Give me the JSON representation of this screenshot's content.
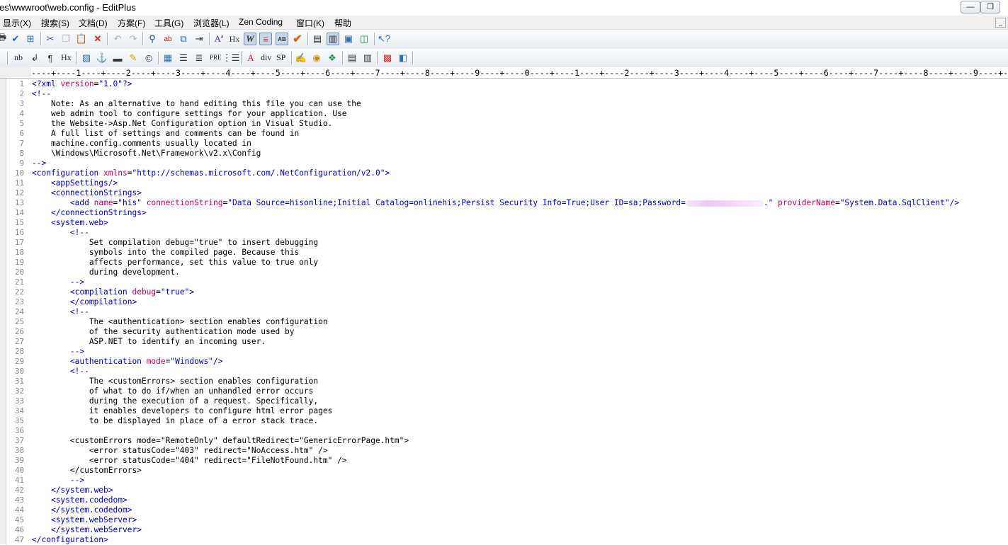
{
  "window": {
    "title": "es\\wwwroot\\web.config - EditPlus",
    "min_glyph": "—",
    "restore_glyph": "❐"
  },
  "menu": {
    "items": [
      "显示(X)",
      "搜索(S)",
      "文档(D)",
      "方案(F)",
      "工具(G)",
      "浏览器(L)",
      "Zen Coding",
      "窗口(K)",
      "帮助"
    ]
  },
  "toolbar2_text": {
    "nb": "nb",
    "hx": "Hx",
    "pre": "PRE",
    "div": "div",
    "sp": "SP"
  },
  "ruler": "----+----1----+----2----+----3----+----4----+----5----+----6----+----7----+----8----+----9----+----0----+----1----+----2----+----3----+----4----+----5----+----6----+----7----+----8----+----9----+----",
  "editor": {
    "line_numbers": [
      "1",
      "2",
      "3",
      "4",
      "5",
      "6",
      "7",
      "8",
      "9",
      "10",
      "11",
      "12",
      "13",
      "14",
      "15",
      "16",
      "17",
      "18",
      "19",
      "20",
      "21",
      "22",
      "23",
      "24",
      "25",
      "26",
      "27",
      "28",
      "29",
      "30",
      "31",
      "32",
      "33",
      "34",
      "35",
      "36",
      "37",
      "38",
      "39",
      "40",
      "41",
      "42",
      "43",
      "44",
      "45",
      "46",
      "47"
    ],
    "lines": [
      "<?xml version=\"1.0\"?>",
      "<!--",
      "    Note: As an alternative to hand editing this file you can use the",
      "    web admin tool to configure settings for your application. Use",
      "    the Website->Asp.Net Configuration option in Visual Studio.",
      "    A full list of settings and comments can be found in",
      "    machine.config.comments usually located in",
      "    \\Windows\\Microsoft.Net\\Framework\\v2.x\\Config",
      "-->",
      "<configuration xmlns=\"http://schemas.microsoft.com/.NetConfiguration/v2.0\">",
      "    <appSettings/>",
      "    <connectionStrings>",
      "        <add name=\"his\" connectionString=\"Data Source=hisonline;Initial Catalog=onlinehis;Persist Security Info=True;User ID=sa;Password=",
      "    </connectionStrings>",
      "    <system.web>",
      "        <!--",
      "            Set compilation debug=\"true\" to insert debugging",
      "            symbols into the compiled page. Because this",
      "            affects performance, set this value to true only",
      "            during development.",
      "        -->",
      "        <compilation debug=\"true\">",
      "        </compilation>",
      "        <!--",
      "            The <authentication> section enables configuration",
      "            of the security authentication mode used by",
      "            ASP.NET to identify an incoming user.",
      "        -->",
      "        <authentication mode=\"Windows\"/>",
      "        <!--",
      "            The <customErrors> section enables configuration",
      "            of what to do if/when an unhandled error occurs",
      "            during the execution of a request. Specifically,",
      "            it enables developers to configure html error pages",
      "            to be displayed in place of a error stack trace.",
      "",
      "        <customErrors mode=\"RemoteOnly\" defaultRedirect=\"GenericErrorPage.htm\">",
      "            <error statusCode=\"403\" redirect=\"NoAccess.htm\" />",
      "            <error statusCode=\"404\" redirect=\"FileNotFound.htm\" />",
      "        </customErrors>",
      "        -->",
      "    </system.web>",
      "    <system.codedom>",
      "    </system.codedom>",
      "    <system.webServer>",
      "    </system.webServer>",
      "</configuration>"
    ],
    "line13_tail": ".\" providerName=\"System.Data.SqlClient\"/>"
  },
  "colors": {
    "tag": "#0000cc",
    "attribute": "#cc0066",
    "value": "#0000cc",
    "line_number": "#8a8a8a"
  }
}
